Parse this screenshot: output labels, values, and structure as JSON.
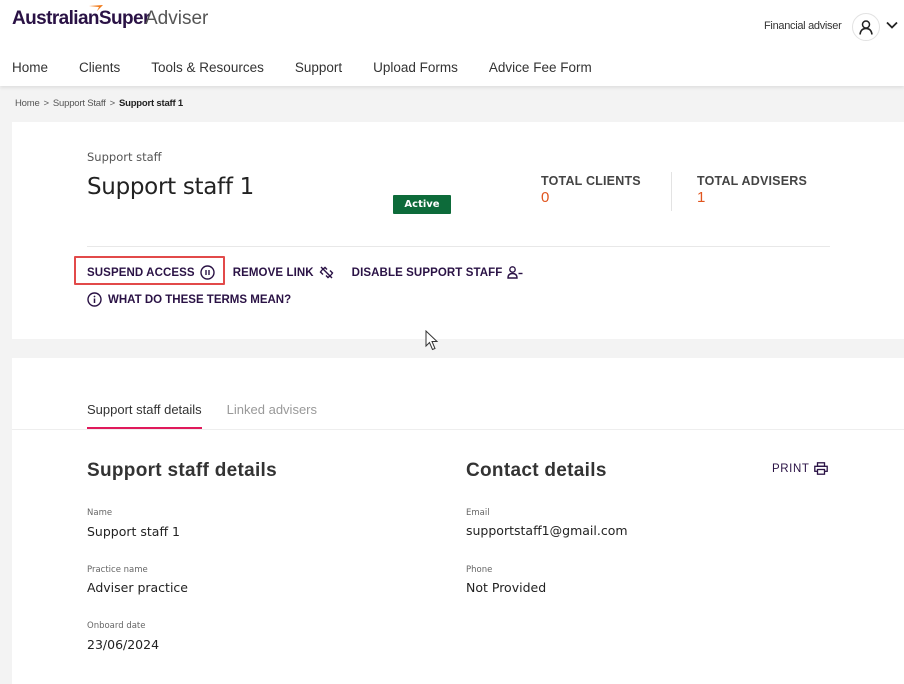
{
  "header": {
    "brand": "AustralianSuper",
    "app_name": "Adviser",
    "user_role": "Financial adviser",
    "colors": {
      "brand_purple": "#2a1245",
      "brand_orange": "#f07a1a"
    }
  },
  "nav": {
    "items": [
      {
        "label": "Home"
      },
      {
        "label": "Clients"
      },
      {
        "label": "Tools & Resources"
      },
      {
        "label": "Support"
      },
      {
        "label": "Upload Forms"
      },
      {
        "label": "Advice Fee Form"
      }
    ]
  },
  "breadcrumb": {
    "items": [
      {
        "label": "Home"
      },
      {
        "label": "Support Staff"
      },
      {
        "label": "Support staff 1"
      }
    ],
    "separator": ">"
  },
  "profile": {
    "eyebrow": "Support staff",
    "title": "Support staff 1",
    "status": "Active",
    "status_color": "#0d6b3a",
    "stats": [
      {
        "label": "TOTAL CLIENTS",
        "value": "0"
      },
      {
        "label": "TOTAL ADVISERS",
        "value": "1"
      }
    ],
    "stat_value_color": "#e0551e",
    "actions": [
      {
        "label": "SUSPEND ACCESS",
        "icon": "pause-circle-icon"
      },
      {
        "label": "REMOVE LINK",
        "icon": "unlink-icon"
      },
      {
        "label": "DISABLE SUPPORT STAFF",
        "icon": "user-minus-icon"
      }
    ],
    "terms_link": "WHAT DO THESE TERMS MEAN?"
  },
  "tabs": [
    {
      "label": "Support staff details",
      "active": true
    },
    {
      "label": "Linked advisers",
      "active": false
    }
  ],
  "details": {
    "section_title": "Support staff details",
    "fields": [
      {
        "label": "Name",
        "value": "Support staff 1"
      },
      {
        "label": "Practice name",
        "value": "Adviser practice"
      },
      {
        "label": "Onboard date",
        "value": "23/06/2024"
      }
    ]
  },
  "contact": {
    "section_title": "Contact details",
    "print_label": "PRINT",
    "fields": [
      {
        "label": "Email",
        "value": "supportstaff1@gmail.com"
      },
      {
        "label": "Phone",
        "value": "Not Provided"
      }
    ]
  }
}
